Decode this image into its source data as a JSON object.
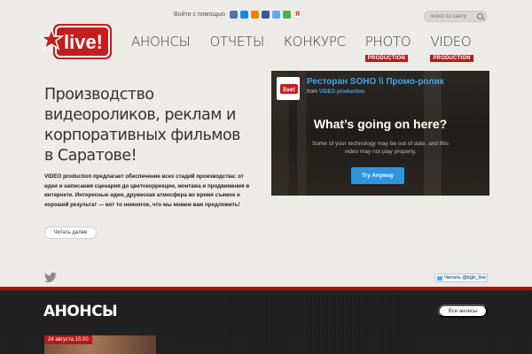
{
  "header": {
    "login_label": "Войти с помощью",
    "social_icons": [
      {
        "name": "vk-icon",
        "color": "#4a76a8"
      },
      {
        "name": "mailru-icon",
        "color": "#168de2"
      },
      {
        "name": "odnoklassniki-icon",
        "color": "#ee8208"
      },
      {
        "name": "facebook-icon",
        "color": "#3b5998"
      },
      {
        "name": "twitter-icon",
        "color": "#55acee"
      },
      {
        "name": "google-icon",
        "color": "#4caf50"
      },
      {
        "name": "yandex-icon",
        "color": "#e61400"
      }
    ],
    "search_placeholder": "поиск по сайту"
  },
  "logo": {
    "text": "live!",
    "color": "#c41e1e"
  },
  "nav": [
    {
      "label": "АНОНСЫ"
    },
    {
      "label": "ОТЧЕТЫ"
    },
    {
      "label": "КОНКУРС"
    },
    {
      "label": "PHOTO",
      "badge": "PRODUCTION"
    },
    {
      "label": "VIDEO",
      "badge": "PRODUCTION"
    }
  ],
  "hero": {
    "headline": "Производство видеороликов, реклам и корпоративных фильмов в Саратове!",
    "paragraph": "VIDEO production предлагает обеспечение всех стадий производства: от идеи и написания сценария до цветокоррекции, монтажа и продвижения в интернете.    Интересные идеи, дружеская атмосфера во время съемок и хороший результат — вот то немногое, что мы можем вам предложить!",
    "more_button": "Читать далее"
  },
  "video": {
    "title": "Ресторан SOHO \\\\ Промо-ролик",
    "from_prefix": "from",
    "from_name": "VIDEO production",
    "question": "What’s going on here?",
    "message": "Some of your technology may be out of date, and this video may not play properly.",
    "try_button": "Try Anyway"
  },
  "twitter": {
    "follow_label": "Читать @kgb_live"
  },
  "announcements": {
    "title": "АНОНСЫ",
    "all_button": "Все анонсы",
    "items": [
      {
        "date": "24 августа 15:00"
      }
    ]
  },
  "colors": {
    "accent": "#b61b1b",
    "link": "#41a5e8"
  }
}
